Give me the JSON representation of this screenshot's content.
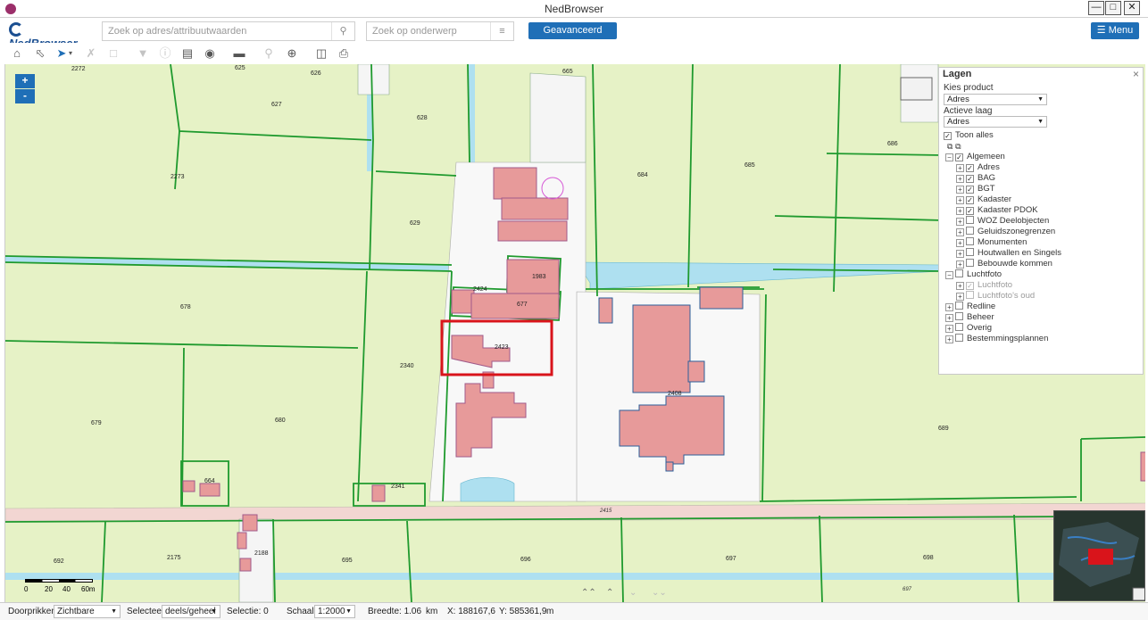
{
  "window": {
    "title": "NedBrowser"
  },
  "header": {
    "logo_text": "NedBrowser",
    "search_address_placeholder": "Zoek op adres/attribuutwaarden",
    "search_subject_placeholder": "Zoek op onderwerp",
    "advanced_search_label": "Geavanceerd zoeken",
    "menu_label": "Menu"
  },
  "zoom": {
    "in": "+",
    "out": "-"
  },
  "panel": {
    "title": "Lagen",
    "product_label": "Kies product",
    "product_value": "Adres",
    "layer_label": "Actieve laag",
    "layer_value": "Adres",
    "show_all": "Toon alles",
    "layers": [
      {
        "label": "Algemeen",
        "checked": true,
        "level": 0
      },
      {
        "label": "Adres",
        "checked": true,
        "level": 1
      },
      {
        "label": "BAG",
        "checked": true,
        "level": 1
      },
      {
        "label": "BGT",
        "checked": true,
        "level": 1
      },
      {
        "label": "Kadaster",
        "checked": true,
        "level": 1
      },
      {
        "label": "Kadaster PDOK",
        "checked": true,
        "level": 1
      },
      {
        "label": "WOZ Deelobjecten",
        "checked": false,
        "level": 1
      },
      {
        "label": "Geluidszonegrenzen",
        "checked": false,
        "level": 1
      },
      {
        "label": "Monumenten",
        "checked": false,
        "level": 1
      },
      {
        "label": "Houtwallen en Singels",
        "checked": false,
        "level": 1
      },
      {
        "label": "Bebouwde kommen",
        "checked": false,
        "level": 1
      },
      {
        "label": "Luchtfoto",
        "checked": false,
        "level": 0
      },
      {
        "label": "Luchtfoto",
        "checked": true,
        "level": 1,
        "dim": true
      },
      {
        "label": "Luchtfoto's oud",
        "checked": false,
        "level": 1,
        "dim": true
      },
      {
        "label": "Redline",
        "checked": false,
        "level": 0
      },
      {
        "label": "Beheer",
        "checked": false,
        "level": 0
      },
      {
        "label": "Overig",
        "checked": false,
        "level": 0
      },
      {
        "label": "Bestemmingsplannen",
        "checked": false,
        "level": 0
      }
    ]
  },
  "map": {
    "parcel_labels": [
      "2272",
      "625",
      "626",
      "627",
      "628",
      "665",
      "684",
      "685",
      "686",
      "2273",
      "629",
      "2424",
      "1983",
      "677",
      "678",
      "2423",
      "2340",
      "2408",
      "679",
      "680",
      "689",
      "664",
      "2341",
      "2415",
      "692",
      "2175",
      "2188",
      "695",
      "696",
      "697",
      "698",
      "697"
    ],
    "scale_ticks": [
      "0",
      "20",
      "40",
      "60m"
    ]
  },
  "statusbar": {
    "doorprikken_label": "Doorprikken:",
    "doorprikken_value": "Zichtbare",
    "selecteer_label": "Selecteer:",
    "selecteer_value": "deels/geheel",
    "selectie": "Selectie: 0",
    "schaal_label": "Schaal:",
    "schaal_value": "1:2000",
    "breedte_label": "Breedte: 1.06",
    "breedte_unit": "km",
    "x_coord": "X: 188167,6",
    "y_coord": "Y: 585361,9",
    "coord_unit": "m"
  },
  "colors": {
    "accent": "#1f6fb7",
    "parcel_border": "#1f9a2e",
    "building": "#e79a9a",
    "selection": "#d9141b"
  }
}
